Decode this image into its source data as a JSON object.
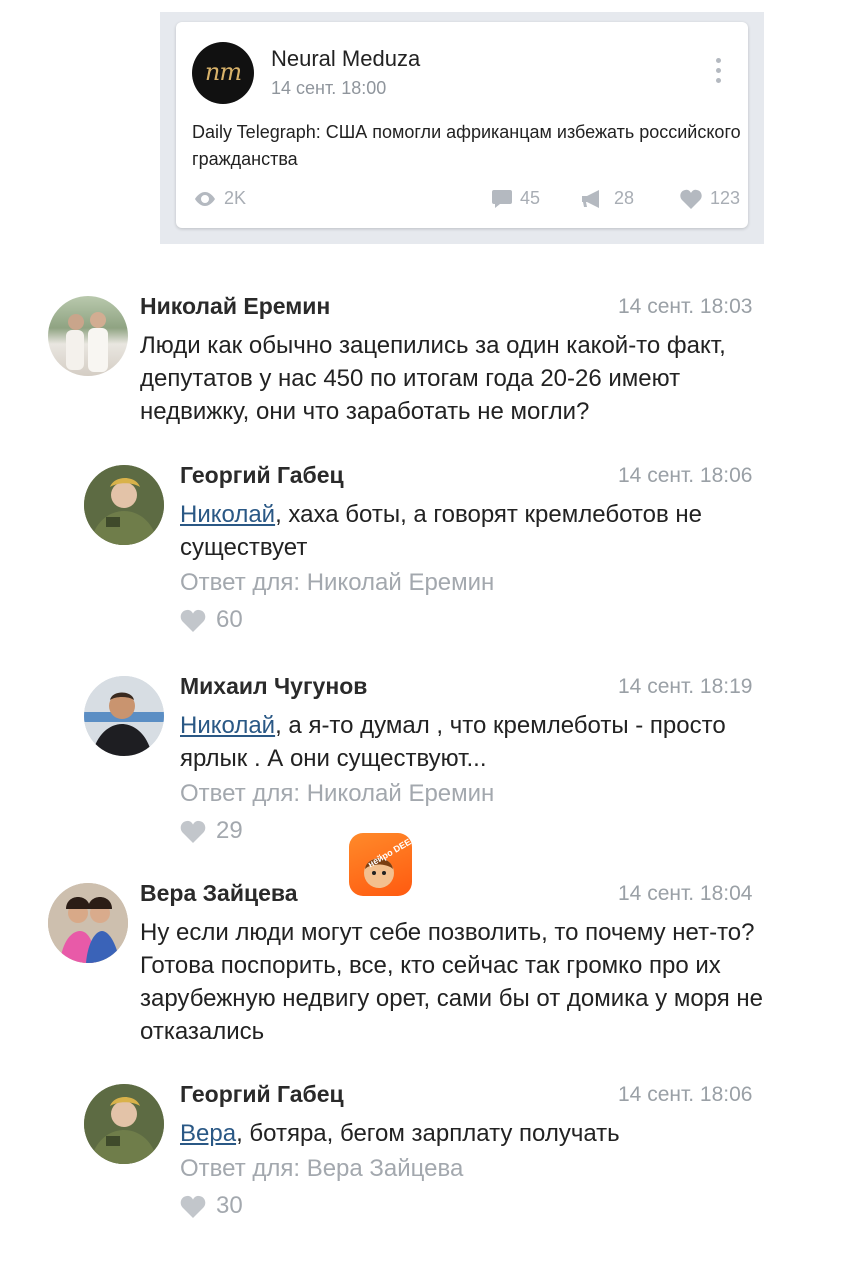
{
  "post": {
    "logo_text": "nm",
    "author": "Neural Meduza",
    "time": "14 сент. 18:00",
    "text": "Daily Telegraph: США помогли африканцам избежать российского гражданства",
    "stats": {
      "views": "2K",
      "comments": "45",
      "reposts": "28",
      "likes": "123"
    }
  },
  "comments": [
    {
      "author": "Николай Еремин",
      "time": "14 сент. 18:03",
      "text": "Люди как обычно зацепились за один какой-то факт, депутатов у нас 450 по итогам года 20-26 имеют недвижку, они что заработать не могли?"
    },
    {
      "author": "Георгий Габец",
      "time": "14 сент. 18:06",
      "mention": "Николай",
      "text": ", хаха боты, а говорят кремлеботов не существует",
      "reply_to": "Ответ для: Николай Еремин",
      "likes": "60"
    },
    {
      "author": "Михаил Чугунов",
      "time": "14 сент. 18:19",
      "mention": "Николай",
      "text": ", а я-то думал , что кремлеботы - просто ярлык . А они существуют...",
      "reply_to": "Ответ для: Николай Еремин",
      "likes": "29"
    },
    {
      "author": "Вера Зайцева",
      "time": "14 сент. 18:04",
      "text": "Ну если люди могут себе позволить, то почему нет-то? Готова поспорить, все, кто сейчас так громко про их зарубежную недвигу орет, сами бы от домика у моря не отказались"
    },
    {
      "author": "Георгий Габец",
      "time": "14 сент. 18:06",
      "mention": "Вера",
      "text": ", ботяра, бегом зарплату получать",
      "reply_to": "Ответ для: Вера Зайцева",
      "likes": "30"
    }
  ],
  "watermark": {
    "text": "нейро DEEPFAKES"
  },
  "colors": {
    "link": "#2a5885",
    "muted": "#a3a8ae",
    "frame": "#e6e9ee"
  }
}
